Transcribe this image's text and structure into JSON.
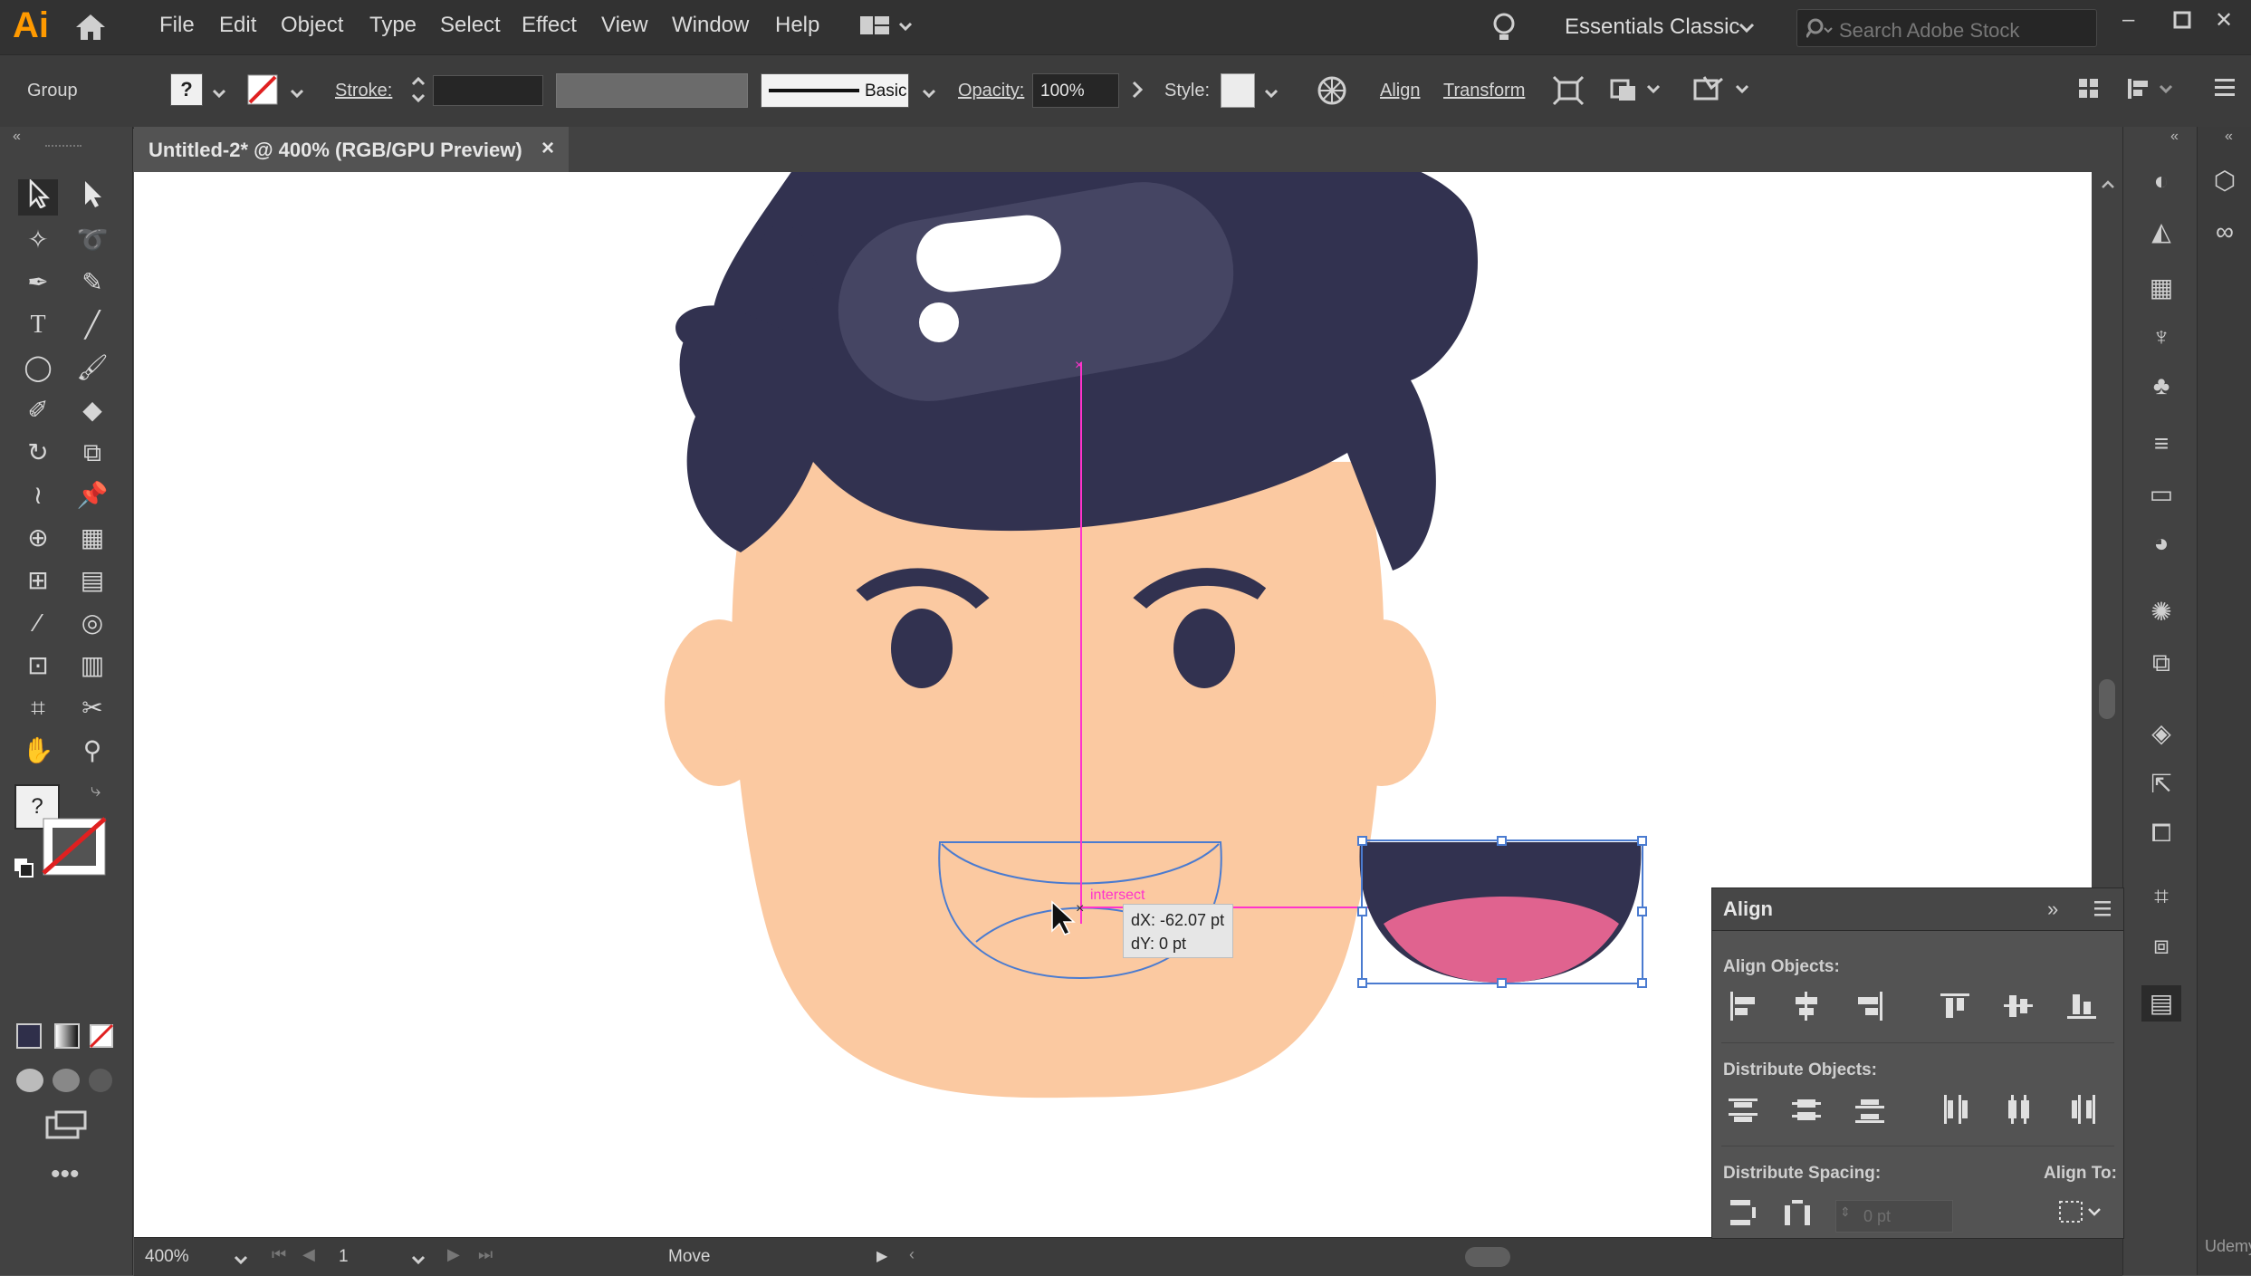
{
  "app": {
    "logo": "Ai"
  },
  "menu": [
    "File",
    "Edit",
    "Object",
    "Type",
    "Select",
    "Effect",
    "View",
    "Window",
    "Help"
  ],
  "workspace": "Essentials Classic",
  "search": {
    "placeholder": "Search Adobe Stock"
  },
  "control": {
    "selection": "Group",
    "stroke_label": "Stroke:",
    "brush": "Basic",
    "opacity_label": "Opacity:",
    "opacity_value": "100%",
    "style_label": "Style:",
    "align_link": "Align",
    "transform_link": "Transform"
  },
  "document": {
    "tab_title": "Untitled-2* @ 400% (RGB/GPU Preview)",
    "close": "×"
  },
  "canvas": {
    "smart_guide": "intersect",
    "tooltip_dx": "dX: -62.07 pt",
    "tooltip_dy": "dY: 0 pt",
    "colors": {
      "hair": "#323250",
      "hair_highlight": "#454563",
      "skin": "#fbc9a1",
      "tongue": "#e0638f",
      "guide": "#ff33cc",
      "selection": "#4a7bd0"
    }
  },
  "tools": {
    "fill_unknown": "?"
  },
  "status": {
    "zoom": "400%",
    "artboard": "1",
    "action": "Move"
  },
  "align_panel": {
    "title": "Align",
    "align_objects": "Align Objects:",
    "distribute_objects": "Distribute Objects:",
    "distribute_spacing": "Distribute Spacing:",
    "align_to": "Align To:",
    "spacing_value": "0 pt"
  },
  "watermark": "Udemy"
}
